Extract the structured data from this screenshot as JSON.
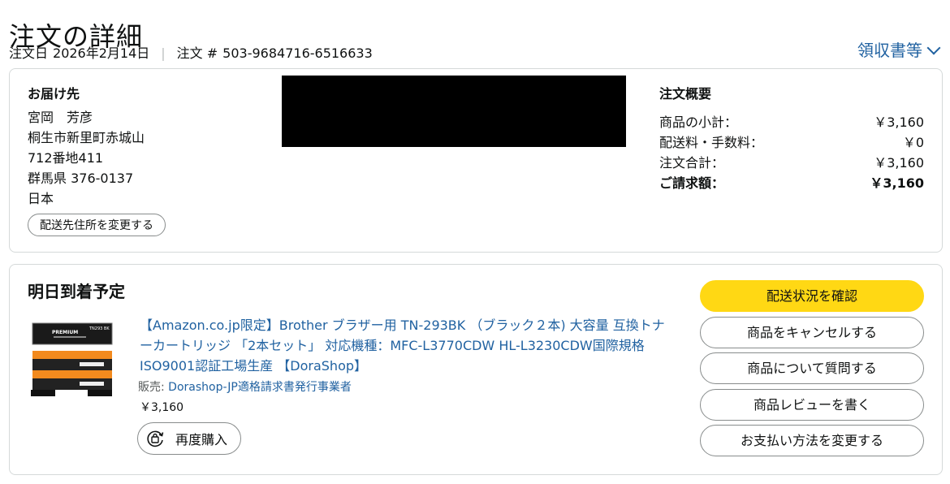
{
  "header": {
    "title": "注文の詳細",
    "order_date_label": "注文日",
    "order_date": "2026年2月14日",
    "order_number_label": "注文 #",
    "order_number": "503-9684716-6516633",
    "receipt_link": "領収書等"
  },
  "shipping": {
    "heading": "お届け先",
    "name": "宮岡　芳彦",
    "address_line1": "桐生市新里町赤城山",
    "address_line2": "712番地411",
    "address_line3": "群馬県 376-0137",
    "country": "日本",
    "change_button": "配送先住所を変更する"
  },
  "summary": {
    "heading": "注文概要",
    "rows": [
      {
        "label": "商品の小計：",
        "value": "￥3,160"
      },
      {
        "label": "配送料・手数料：",
        "value": "￥0"
      },
      {
        "label": "注文合計：",
        "value": "￥3,160"
      },
      {
        "label": "ご請求額：",
        "value": "￥3,160"
      }
    ]
  },
  "shipment": {
    "arrival": "明日到着予定",
    "product_title": "【Amazon.co.jp限定】Brother ブラザー用 TN-293BK （ブラック２本) 大容量 互換トナーカートリッジ 「2本セット」 対応機種：MFC-L3770CDW HL-L3230CDW国際規格ISO9001認証工場生産 【DoraShop】",
    "seller_label": "販売:",
    "seller_name": "Dorashop-JP適格請求書発行事業者",
    "price": "￥3,160",
    "rebuy_button": "再度購入",
    "thumb_text_premium": "PREMIUM",
    "thumb_text_model": "TN293 BK",
    "actions": [
      "配送状況を確認",
      "商品をキャンセルする",
      "商品について質問する",
      "商品レビューを書く",
      "お支払い方法を変更する"
    ]
  },
  "colors": {
    "link": "#2162a1",
    "primary_button": "#ffd814",
    "border": "#d5d9d9",
    "toner_orange": "#f28a1e"
  }
}
